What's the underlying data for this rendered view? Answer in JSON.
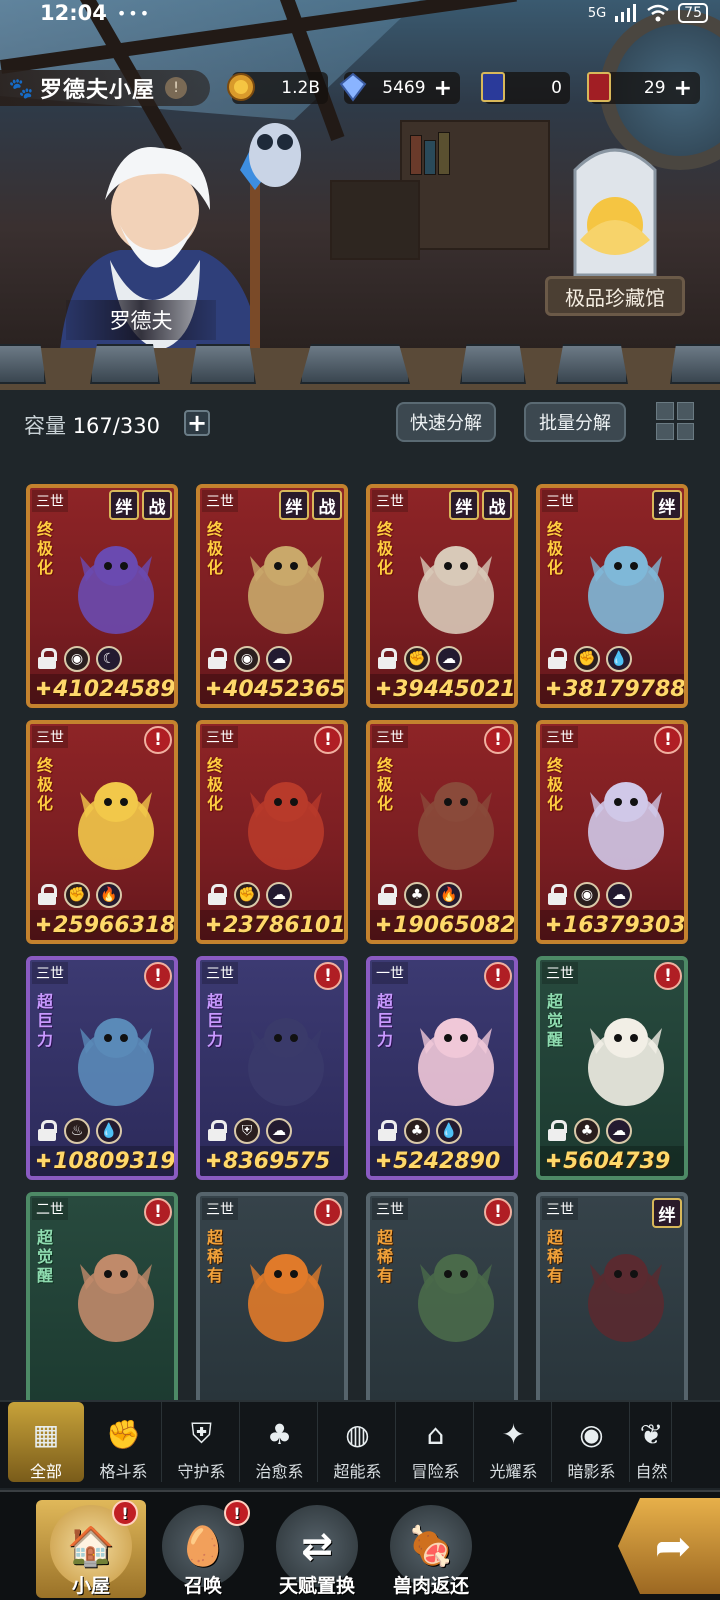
{
  "status_bar": {
    "time": "12:04",
    "dots": "•••",
    "network": "5G",
    "battery": "75"
  },
  "location": {
    "name": "罗德夫小屋",
    "info_icon": "!"
  },
  "resources": [
    {
      "icon": "gold-coin-icon",
      "value": "1.2B",
      "has_plus": false
    },
    {
      "icon": "crystal-icon",
      "value": "5469",
      "has_plus": true
    },
    {
      "icon": "ticket-card-icon",
      "value": "0",
      "has_plus": false
    },
    {
      "icon": "gold-card-icon",
      "value": "29",
      "has_plus": true
    }
  ],
  "npc": {
    "name": "罗德夫"
  },
  "museum": {
    "label": "极品珍藏馆"
  },
  "storage": {
    "label": "容量",
    "value": "167/330"
  },
  "actions": {
    "quick_decompose": "快速分解",
    "batch_decompose": "批量分解"
  },
  "tag_labels": {
    "bond": "绊",
    "battle": "战",
    "alert": "!"
  },
  "cards": [
    {
      "gen": "三世",
      "rank": "终极化",
      "tags": [
        "绊",
        "战"
      ],
      "power": "41024589",
      "theme": "red"
    },
    {
      "gen": "三世",
      "rank": "终极化",
      "tags": [
        "绊",
        "战"
      ],
      "power": "40452365",
      "theme": "red"
    },
    {
      "gen": "三世",
      "rank": "终极化",
      "tags": [
        "绊",
        "战"
      ],
      "power": "39445021",
      "theme": "red"
    },
    {
      "gen": "三世",
      "rank": "终极化",
      "tags": [
        "绊"
      ],
      "power": "38179788",
      "theme": "red"
    },
    {
      "gen": "三世",
      "rank": "终极化",
      "tags": [
        "!"
      ],
      "power": "25966318",
      "theme": "red"
    },
    {
      "gen": "三世",
      "rank": "终极化",
      "tags": [
        "!"
      ],
      "power": "23786101",
      "theme": "red"
    },
    {
      "gen": "三世",
      "rank": "终极化",
      "tags": [
        "!"
      ],
      "power": "19065082",
      "theme": "red"
    },
    {
      "gen": "三世",
      "rank": "终极化",
      "tags": [
        "!"
      ],
      "power": "16379303",
      "theme": "red"
    },
    {
      "gen": "三世",
      "rank": "超巨力",
      "tags": [
        "!"
      ],
      "power": "10809319",
      "theme": "purple"
    },
    {
      "gen": "三世",
      "rank": "超巨力",
      "tags": [
        "!"
      ],
      "power": "8369575",
      "theme": "purple"
    },
    {
      "gen": "一世",
      "rank": "超巨力",
      "tags": [
        "!"
      ],
      "power": "5242890",
      "theme": "purple"
    },
    {
      "gen": "三世",
      "rank": "超觉醒",
      "tags": [
        "!"
      ],
      "power": "5604739",
      "theme": "green"
    },
    {
      "gen": "二世",
      "rank": "超觉醒",
      "tags": [
        "!"
      ],
      "power": "",
      "theme": "green"
    },
    {
      "gen": "三世",
      "rank": "超稀有",
      "tags": [
        "!"
      ],
      "power": "",
      "theme": "gray"
    },
    {
      "gen": "三世",
      "rank": "超稀有",
      "tags": [
        "!"
      ],
      "power": "",
      "theme": "gray"
    },
    {
      "gen": "三世",
      "rank": "超稀有",
      "tags": [
        "绊"
      ],
      "power": "",
      "theme": "gray"
    }
  ],
  "filters": [
    {
      "label": "全部",
      "icon": "blocks-icon",
      "active": true
    },
    {
      "label": "格斗系",
      "icon": "fist-icon"
    },
    {
      "label": "守护系",
      "icon": "shield-icon"
    },
    {
      "label": "治愈系",
      "icon": "sprout-icon"
    },
    {
      "label": "超能系",
      "icon": "alien-icon"
    },
    {
      "label": "冒险系",
      "icon": "lantern-icon"
    },
    {
      "label": "光耀系",
      "icon": "star-burst-icon"
    },
    {
      "label": "暗影系",
      "icon": "eye-icon"
    },
    {
      "label": "自然",
      "icon": "leaf-icon"
    }
  ],
  "nav": [
    {
      "label": "小屋",
      "icon": "house-icon",
      "badge": "!",
      "active": true
    },
    {
      "label": "召唤",
      "icon": "egg-icon",
      "badge": "!"
    },
    {
      "label": "天赋置换",
      "icon": "exchange-icon"
    },
    {
      "label": "兽肉返还",
      "icon": "meat-icon"
    }
  ]
}
